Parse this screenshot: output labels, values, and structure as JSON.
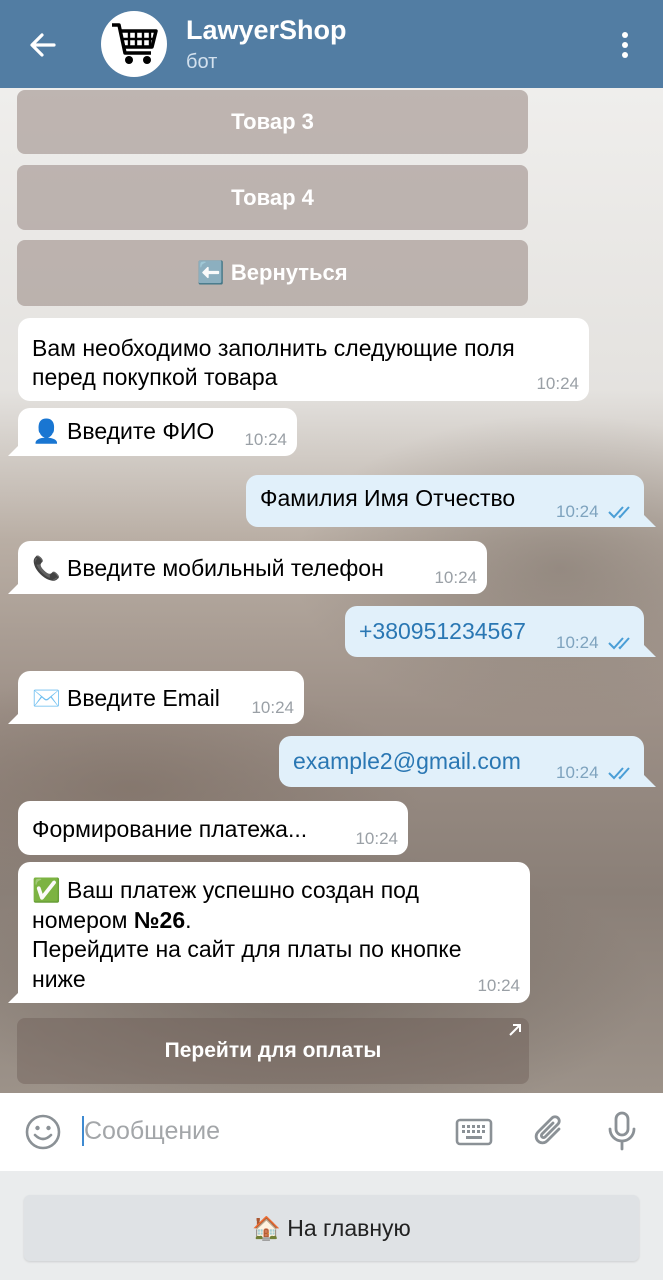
{
  "header": {
    "title": "LawyerShop",
    "subtitle": "бот",
    "back_icon": "arrow-left-icon",
    "avatar_icon": "shopping-cart-icon",
    "more_icon": "more-vertical-icon"
  },
  "keyboard_buttons": {
    "item3": "Товар 3",
    "item4": "Товар 4",
    "back": "⬅️ Вернуться"
  },
  "messages": [
    {
      "dir": "in",
      "text_line1": "Вам необходимо заполнить следующие поля",
      "text_line2": "перед покупкой товара",
      "time": "10:24"
    },
    {
      "dir": "in",
      "text": "👤 Введите ФИО",
      "time": "10:24"
    },
    {
      "dir": "out",
      "text": "Фамилия Имя Отчество",
      "time": "10:24",
      "read": true
    },
    {
      "dir": "in",
      "text": "📞 Введите мобильный телефон",
      "time": "10:24"
    },
    {
      "dir": "out",
      "text": "+380951234567",
      "time": "10:24",
      "read": true
    },
    {
      "dir": "in",
      "text": "✉️ Введите Email",
      "time": "10:24"
    },
    {
      "dir": "out",
      "text": "example2@gmail.com",
      "time": "10:24",
      "read": true
    },
    {
      "dir": "in",
      "text": "Формирование платежа...",
      "time": "10:24"
    },
    {
      "dir": "in",
      "text_line1_prefix": "✅ Ваш платеж успешно создан под",
      "text_line2_prefix": "номером ",
      "text_line2_bold": "№26",
      "text_line2_suffix": ".",
      "text_line3": "Перейдите на сайт для платы по кнопке",
      "text_line4": "ниже",
      "time": "10:24"
    }
  ],
  "pay_button": {
    "label": "Перейти для оплаты",
    "icon": "external-link-arrow-icon"
  },
  "input": {
    "placeholder": "Сообщение",
    "value": "",
    "emoji_icon": "emoji-icon",
    "keyboard_icon": "keyboard-icon",
    "attach_icon": "paperclip-icon",
    "mic_icon": "microphone-icon"
  },
  "reply_keyboard": {
    "home_label": "🏠 На главную"
  },
  "colors": {
    "header": "#527da3",
    "outgoing": "#e1f0fa",
    "incoming": "#ffffff",
    "link": "#2a77b3"
  }
}
